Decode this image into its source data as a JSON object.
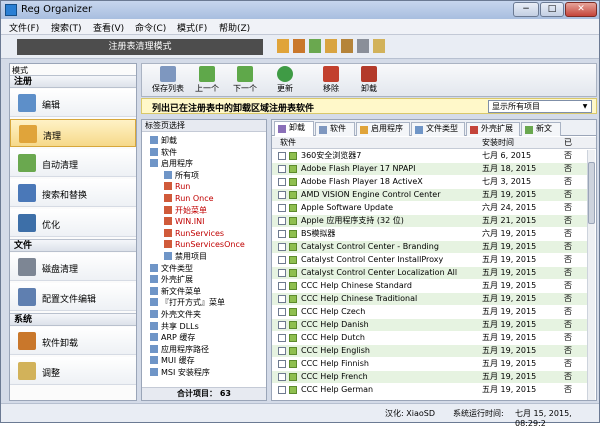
{
  "app": {
    "title": "Reg Organizer"
  },
  "window_buttons": [
    "−",
    "□",
    "✕"
  ],
  "menu": [
    "文件(F)",
    "搜索(T)",
    "查看(V)",
    "命令(C)",
    "模式(F)",
    "帮助(Z)"
  ],
  "mode_bar": "注册表清理模式",
  "left": {
    "label": "模式",
    "sections": [
      {
        "title": "注册",
        "items": [
          "编辑",
          "清理",
          "自动清理",
          "搜索和替换",
          "优化"
        ]
      },
      {
        "title": "文件",
        "items": [
          "磁盘清理",
          "配置文件编辑"
        ]
      },
      {
        "title": "系统",
        "items": [
          "软件卸载",
          "调整"
        ]
      }
    ]
  },
  "toolbar": [
    "保存列表",
    "上一个",
    "下一个",
    "更新",
    "移除",
    "卸载"
  ],
  "infobar": {
    "text": "列出已在注册表中的卸载区域注册表软件",
    "dropdown": "显示所有项目"
  },
  "tree": {
    "title": "标签页选择",
    "nodes": [
      {
        "label": "卸载",
        "depth": 1,
        "red": false
      },
      {
        "label": "软件",
        "depth": 1,
        "red": false
      },
      {
        "label": "启用程序",
        "depth": 1,
        "red": false
      },
      {
        "label": "所有项",
        "depth": 2,
        "red": false
      },
      {
        "label": "Run",
        "depth": 2,
        "red": true
      },
      {
        "label": "Run Once",
        "depth": 2,
        "red": true
      },
      {
        "label": "开始菜单",
        "depth": 2,
        "red": true
      },
      {
        "label": "WIN.INI",
        "depth": 2,
        "red": true
      },
      {
        "label": "RunServices",
        "depth": 2,
        "red": true
      },
      {
        "label": "RunServicesOnce",
        "depth": 2,
        "red": true
      },
      {
        "label": "禁用项目",
        "depth": 2,
        "red": false
      },
      {
        "label": "文件类型",
        "depth": 1,
        "red": false
      },
      {
        "label": "外壳扩展",
        "depth": 1,
        "red": false
      },
      {
        "label": "新文件菜单",
        "depth": 1,
        "red": false
      },
      {
        "label": "『打开方式』菜单",
        "depth": 1,
        "red": false
      },
      {
        "label": "外壳文件夹",
        "depth": 1,
        "red": false
      },
      {
        "label": "共享 DLLs",
        "depth": 1,
        "red": false
      },
      {
        "label": "ARP 缓存",
        "depth": 1,
        "red": false
      },
      {
        "label": "应用程序路径",
        "depth": 1,
        "red": false
      },
      {
        "label": "MUI 缓存",
        "depth": 1,
        "red": false
      },
      {
        "label": "MSI 安装程序",
        "depth": 1,
        "red": false
      }
    ],
    "footer": "合计项目：  63"
  },
  "tabs": [
    "卸载",
    "软件",
    "启用程序",
    "文件类型",
    "外壳扩展",
    "新文"
  ],
  "table": {
    "headers": [
      "软件",
      "安装时间",
      "已"
    ],
    "rows": [
      {
        "name": "360安全浏览器7",
        "date": "七月 6, 2015",
        "flag": "否"
      },
      {
        "name": "Adobe Flash Player 17 NPAPI",
        "date": "五月 18, 2015",
        "flag": "否"
      },
      {
        "name": "Adobe Flash Player 18 ActiveX",
        "date": "七月 3, 2015",
        "flag": "否"
      },
      {
        "name": "AMD VISION Engine Control Center",
        "date": "五月 19, 2015",
        "flag": "否"
      },
      {
        "name": "Apple Software Update",
        "date": "六月 24, 2015",
        "flag": "否"
      },
      {
        "name": "Apple 应用程序支持 (32 位)",
        "date": "五月 21, 2015",
        "flag": "否"
      },
      {
        "name": "BS模拟器",
        "date": "六月 19, 2015",
        "flag": "否"
      },
      {
        "name": "Catalyst Control Center - Branding",
        "date": "五月 19, 2015",
        "flag": "否"
      },
      {
        "name": "Catalyst Control Center InstallProxy",
        "date": "五月 19, 2015",
        "flag": "否"
      },
      {
        "name": "Catalyst Control Center Localization All",
        "date": "五月 19, 2015",
        "flag": "否"
      },
      {
        "name": "CCC Help Chinese Standard",
        "date": "五月 19, 2015",
        "flag": "否"
      },
      {
        "name": "CCC Help Chinese Traditional",
        "date": "五月 19, 2015",
        "flag": "否"
      },
      {
        "name": "CCC Help Czech",
        "date": "五月 19, 2015",
        "flag": "否"
      },
      {
        "name": "CCC Help Danish",
        "date": "五月 19, 2015",
        "flag": "否"
      },
      {
        "name": "CCC Help Dutch",
        "date": "五月 19, 2015",
        "flag": "否"
      },
      {
        "name": "CCC Help English",
        "date": "五月 19, 2015",
        "flag": "否"
      },
      {
        "name": "CCC Help Finnish",
        "date": "五月 19, 2015",
        "flag": "否"
      },
      {
        "name": "CCC Help French",
        "date": "五月 19, 2015",
        "flag": "否"
      },
      {
        "name": "CCC Help German",
        "date": "五月 19, 2015",
        "flag": "否"
      }
    ]
  },
  "status": {
    "credit": "汉化: XiaoSD",
    "time_label": "系统运行时间:",
    "time_value": "七月 15, 2015, 08:29:2"
  },
  "colors": {
    "accent_mode_bar": "#4d4d4d",
    "selected_nav": "#f6d98a",
    "row_alt": "#e6f3e1",
    "red_item": "#c00000"
  }
}
